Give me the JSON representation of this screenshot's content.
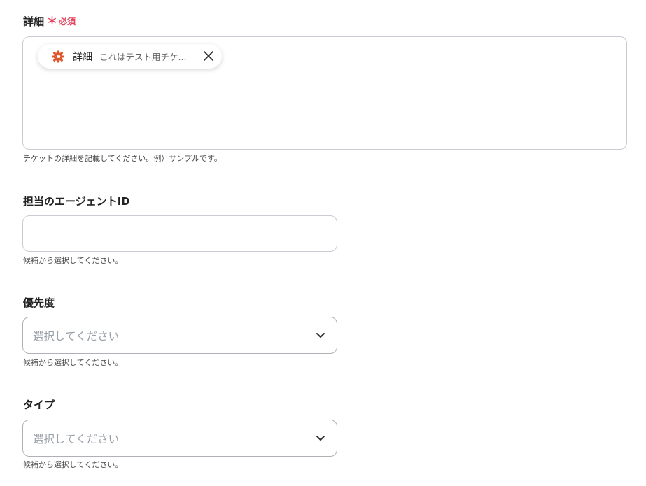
{
  "detail": {
    "label": "詳細",
    "required_mark": "＊",
    "required_text": "必須",
    "chip": {
      "icon": "gear-logo-icon",
      "label": "詳細",
      "value": "これはテスト用チケ...",
      "close_icon": "close-icon"
    },
    "help": "チケットの詳細を記載してください。例）サンプルです。"
  },
  "agent": {
    "label": "担当のエージェントID",
    "value": "",
    "help": "候補から選択してください。"
  },
  "priority": {
    "label": "優先度",
    "placeholder": "選択してください",
    "help": "候補から選択してください。"
  },
  "type": {
    "label": "タイプ",
    "placeholder": "選択してください",
    "help": "候補から選択してください。"
  },
  "colors": {
    "required": "#e6415c",
    "chip_icon": "#e0542a",
    "border": "#c9ccd2",
    "placeholder": "#9aa0a8"
  }
}
